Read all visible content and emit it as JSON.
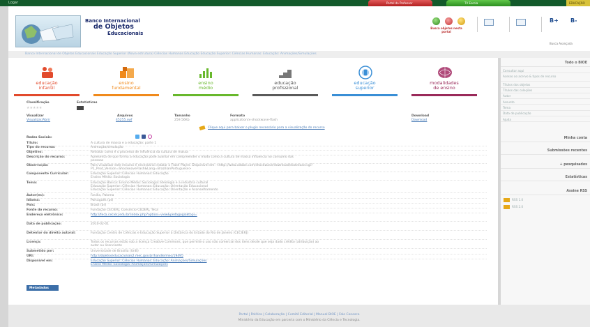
{
  "topbar": {
    "logar": "Logar",
    "tab_professor": "Portal do Professor",
    "tab_tv": "TV Escola",
    "tab_nav": "EDUCAÇÃO"
  },
  "header": {
    "brand_line1": "Banco Internacional",
    "brand_line2": "de Objetos",
    "brand_line3": "Educacionais",
    "search_label": "Busca objetos nesta portal",
    "tool1": "B+",
    "tool2": "B-",
    "busca_avancada": "Busca Avançada"
  },
  "breadcrumb": "Banco Internacional de Objetos Educacionais  Educação Superior (Nova estrutura)  Ciências Humanas  Educação  Educação Superior: Ciências Humanas: Educação: Animações/Simulações",
  "categories": [
    {
      "label1": "educação",
      "label2": "infantil",
      "color": "#e24a2c"
    },
    {
      "label1": "ensino",
      "label2": "fundamental",
      "color": "#f08a1c"
    },
    {
      "label1": "ensino",
      "label2": "médio",
      "color": "#68b82c"
    },
    {
      "label1": "educação",
      "label2": "profissional",
      "color": "#5a5a5a"
    },
    {
      "label1": "educação",
      "label2": "superior",
      "color": "#3a8fd6"
    },
    {
      "label1": "modalidades",
      "label2": "de ensino",
      "color": "#9a2a5a"
    }
  ],
  "info": {
    "classificacao_label": "Classificação",
    "estatisticas_label": "Estatísticas",
    "stars": "★★★★★",
    "visualizar_label": "Visualizar",
    "visualizar_link": "Visualizar/Abrir",
    "arquivos_label": "Arquivos",
    "arquivo_link": "45255.swf",
    "tamanho_label": "Tamanho",
    "tamanho_value": "259.56Kb",
    "formato_label": "Formato",
    "formato_value": "application/x-shockwave-flash",
    "download_label": "Download",
    "download_link": "Download",
    "plugin_text": "Clique aqui para baixar o plugin necessário para a visualização do recurso",
    "redes_label": "Redes Sociais:"
  },
  "details": [
    {
      "k": "Título:",
      "v": "A cultura de massa e a educação: parte 1"
    },
    {
      "k": "Tipo do recurso:",
      "v": "Animação/simulação"
    },
    {
      "k": "Objetivo:",
      "v": "Retratar como é o processo de influência da cultura de massa"
    },
    {
      "k": "Descrição do recurso:",
      "v": "Apresenta de que forma a educação pode auxiliar em compreender o modo como a cultura de massa influencia no consumo das\npessoas"
    },
    {
      "k": "Observação:",
      "v": "Para visualizar este recurso é necessário instalar o Flash Player. Disponível em: <http://www.adobe.com/shockwave/download/download.cgi?\nP1_Prod_Version=ShockwaveFlash&Lang=BrazilianPortuguese>"
    },
    {
      "k": "Componente Curricular:",
      "v": "Educação Superior::Ciências Humanas::Educação\nEnsino Médio::Sociologia"
    },
    {
      "k": "Tema:",
      "v": "Educação Básica::Ensino Médio::Sociologia::Ideologia e a indústria cultural\nEducação Superior::Ciências Humanas::Educação::Orientação Educacional\nEducação Superior::Ciências Humanas::Educação::Orientação e Aconselhamento"
    },
    {
      "k": "Autor(es):",
      "v": "Favilla, Paloma"
    },
    {
      "k": "Idioma:",
      "v": "Português (pt)"
    },
    {
      "k": "País:",
      "v": "Brasil (br)"
    },
    {
      "k": "Fonte do recurso:",
      "v": "Fundação CECIERJ, Consórcio CEDERJ, Teca"
    },
    {
      "k": "Endereço eletrônico:",
      "v": "http://teca.cecierj.edu.br/index.php?option=view&pedagogiaktopi=",
      "link": true
    },
    {
      "k": "Data de publicação:",
      "v": "2010-02-01"
    },
    {
      "k": "Detentor do direito autoral:",
      "v": "Fundação Centro de Ciências e Educação Superior à Distância do Estado do Rio de Janeiro (CECIERJ)"
    },
    {
      "k": "Licença:",
      "v": "Todos os recursos estão sob a licença Creative Commons, que permite o uso não comercial dos itens desde que seja dado crédito (atribuição) ao\nautor ou licenciante"
    },
    {
      "k": "Submetido por:",
      "v": "Universidade de Brasília (UnB)"
    },
    {
      "k": "URI:",
      "v": "http://objetoseducacionais2.mec.gov.br/handle/mec/19495",
      "link": true
    },
    {
      "k": "Disponível em:",
      "v": "Educação Superior::Ciências Humanas::Educação::Animações/Simulações\nEnsino Médio::Sociologia::Animações/Simulações",
      "link": true
    }
  ],
  "metadados_label": "Metadados",
  "sidebar": {
    "head1": "Todo o BIOE",
    "items": [
      "Consultar aqui",
      "Acesso ao acervo & tipos de recurso",
      "Títulos dos objetos",
      "Títulos das coleções",
      "Autor",
      "Assunto",
      "Tema",
      "Data de publicação",
      "Ajuda"
    ],
    "head2": "Minha conta",
    "head3": "Submissões recentes",
    "head4": "+ pesquisados",
    "head5": "Estatísticas",
    "head6": "Assine RSS",
    "rss1": "RSS 1.0",
    "rss2": "RSS 2.0"
  },
  "footer": {
    "links": "Portal  |  Política  |  Colaboração  |  Comitê Editorial  |  Manual BIOE  |  Fale Conosco",
    "line2": "Ministério da Educação em parceria com o Ministério da Ciência e Tecnologia."
  }
}
